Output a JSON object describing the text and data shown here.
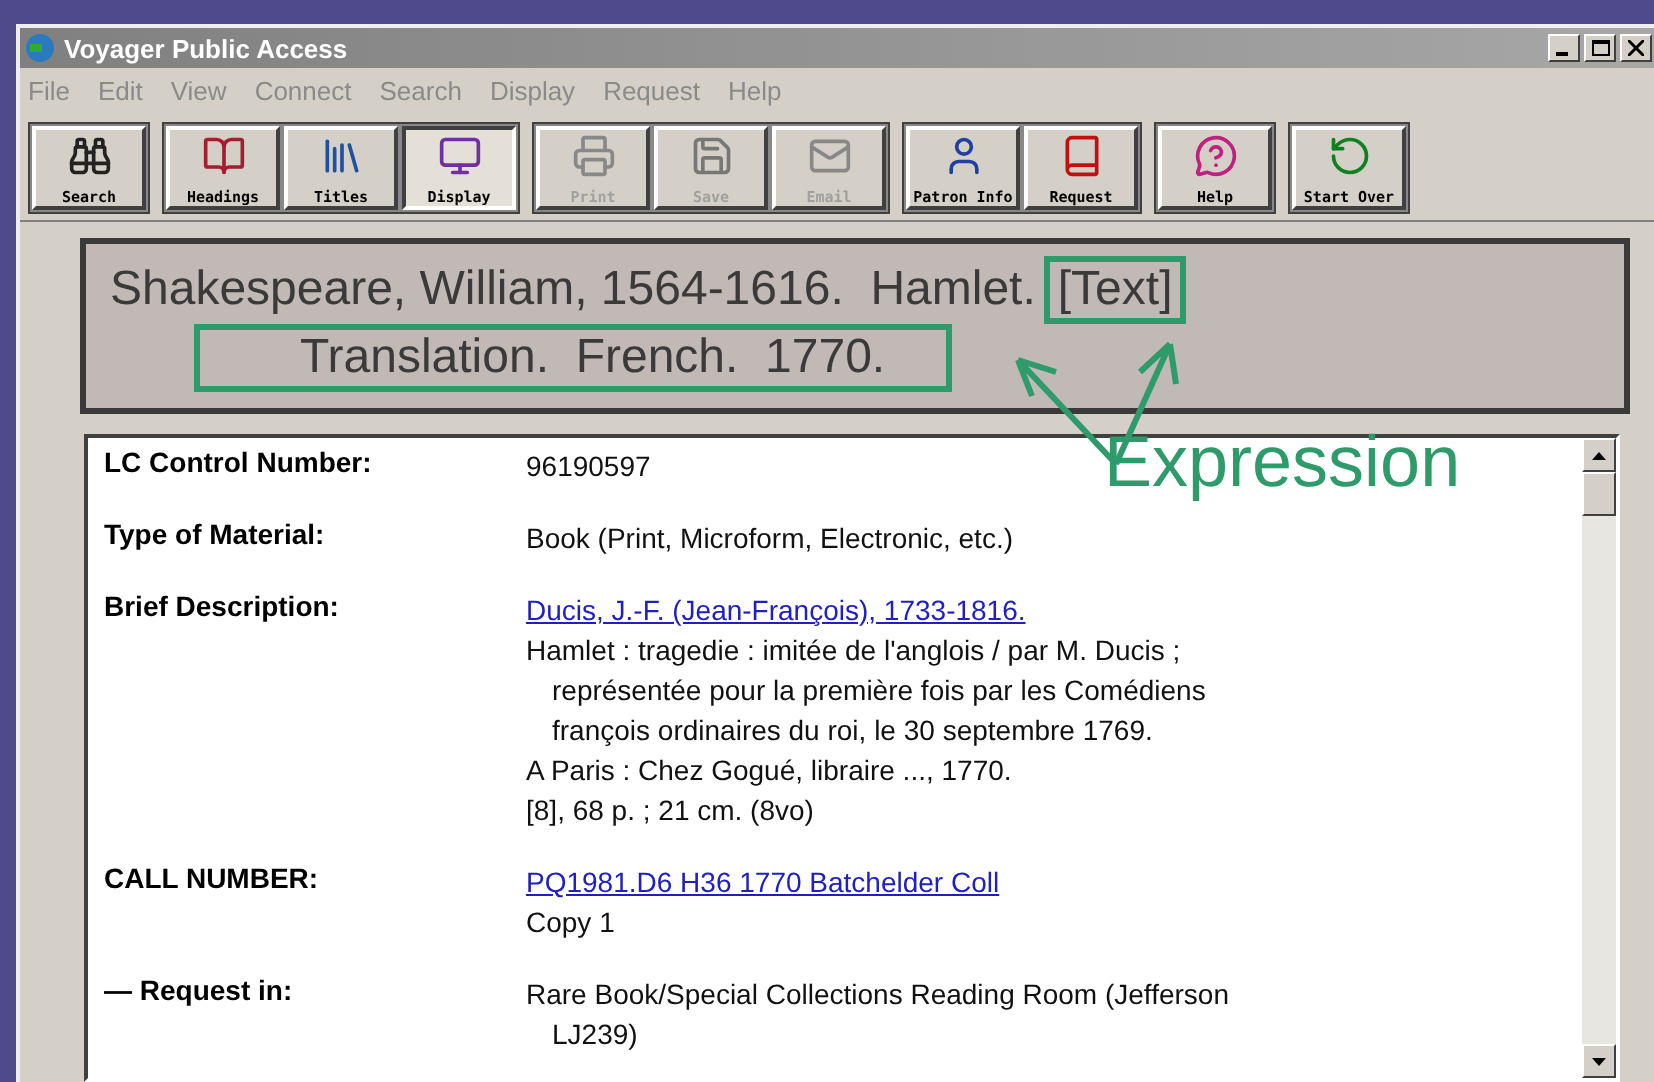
{
  "window": {
    "title": "Voyager Public Access"
  },
  "menu": [
    "File",
    "Edit",
    "View",
    "Connect",
    "Search",
    "Display",
    "Request",
    "Help"
  ],
  "toolbar": [
    [
      {
        "label": "Search",
        "kind": "search",
        "disabled": false,
        "selected": false
      }
    ],
    [
      {
        "label": "Headings",
        "kind": "headings",
        "disabled": false,
        "selected": false
      },
      {
        "label": "Titles",
        "kind": "titles",
        "disabled": false,
        "selected": false
      },
      {
        "label": "Display",
        "kind": "display",
        "disabled": false,
        "selected": true
      }
    ],
    [
      {
        "label": "Print",
        "kind": "print",
        "disabled": true,
        "selected": false
      },
      {
        "label": "Save",
        "kind": "save",
        "disabled": true,
        "selected": false
      },
      {
        "label": "Email",
        "kind": "email",
        "disabled": true,
        "selected": false
      }
    ],
    [
      {
        "label": "Patron Info",
        "kind": "patron",
        "disabled": false,
        "selected": false
      },
      {
        "label": "Request",
        "kind": "request",
        "disabled": false,
        "selected": false
      }
    ],
    [
      {
        "label": "Help",
        "kind": "help",
        "disabled": false,
        "selected": false
      }
    ],
    [
      {
        "label": "Start Over",
        "kind": "startover",
        "disabled": false,
        "selected": false
      }
    ]
  ],
  "heading": {
    "line_1": "Shakespeare, William, 1564-1616.  Hamlet.",
    "form": "[Text]",
    "line_2": "Translation.  French.  1770.",
    "annotation": "Expression"
  },
  "record": [
    {
      "label": "LC Control Number:",
      "lines": [
        {
          "text": "96190597",
          "kind": "text"
        }
      ]
    },
    {
      "label": "Type of Material:",
      "lines": [
        {
          "text": "Book (Print, Microform, Electronic, etc.)",
          "kind": "text"
        }
      ]
    },
    {
      "label": "Brief Description:",
      "lines": [
        {
          "text": "Ducis, J.-F. (Jean-François), 1733-1816.",
          "kind": "link"
        },
        {
          "text": "Hamlet : tragedie : imitée de l'anglois / par M. Ducis ;",
          "kind": "text"
        },
        {
          "text": "représentée pour la première fois par les Comédiens",
          "kind": "continued"
        },
        {
          "text": "françois ordinaires du roi, le 30 septembre 1769.",
          "kind": "continued"
        },
        {
          "text": "A Paris : Chez Gogué, libraire ..., 1770.",
          "kind": "text"
        },
        {
          "text": "[8], 68 p. ; 21 cm. (8vo)",
          "kind": "text"
        }
      ]
    },
    {
      "label": "CALL NUMBER:",
      "lines": [
        {
          "text": "PQ1981.D6 H36 1770 Batchelder Coll",
          "kind": "link"
        },
        {
          "text": "Copy 1",
          "kind": "text"
        }
      ]
    },
    {
      "label": "— Request in:",
      "lines": [
        {
          "text": "Rare Book/Special Collections Reading Room (Jefferson",
          "kind": "text"
        },
        {
          "text": "LJ239)",
          "kind": "continued"
        }
      ]
    }
  ]
}
